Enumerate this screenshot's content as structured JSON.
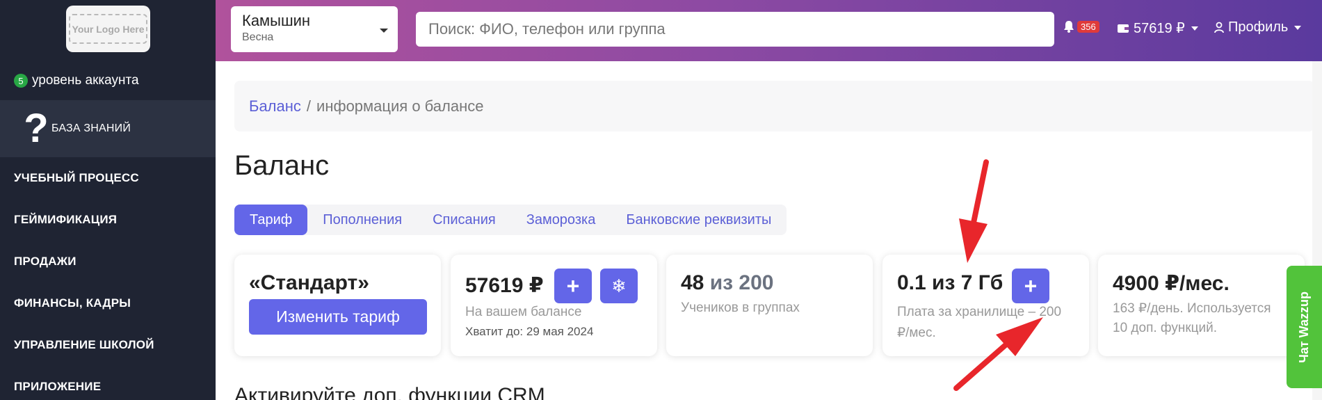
{
  "sidebar": {
    "logo_text": "Your Logo Here",
    "level_badge": "5",
    "level_text": "уровень аккаунта",
    "kb_icon": "?",
    "kb_label": "БАЗА ЗНАНИЙ",
    "items": [
      {
        "label": "УЧЕБНЫЙ ПРОЦЕСС"
      },
      {
        "label": "ГЕЙМИФИКАЦИЯ"
      },
      {
        "label": "ПРОДАЖИ"
      },
      {
        "label": "ФИНАНСЫ, КАДРЫ"
      },
      {
        "label": "УПРАВЛЕНИЕ ШКОЛОЙ"
      },
      {
        "label": "ПРИЛОЖЕНИЕ"
      }
    ]
  },
  "topbar": {
    "branch_name": "Камышин",
    "branch_sub": "Весна",
    "search_placeholder": "Поиск: ФИО, телефон или группа",
    "notifications": "356",
    "wallet": "57619 ₽",
    "profile": "Профиль"
  },
  "breadcrumb": {
    "link": "Баланс",
    "separator": "/",
    "current": "информация о балансе"
  },
  "page_title": "Баланс",
  "tabs": [
    {
      "label": "Тариф"
    },
    {
      "label": "Пополнения"
    },
    {
      "label": "Списания"
    },
    {
      "label": "Заморозка"
    },
    {
      "label": "Банковские реквизиты"
    }
  ],
  "cards": {
    "tariff": {
      "name": "«Стандарт»",
      "button": "Изменить тариф"
    },
    "balance": {
      "amount": "57619 ₽",
      "sub": "На вашем балансе",
      "until": "Хватит до: 29 мая 2024",
      "add_icon": "+",
      "freeze_icon": "❄"
    },
    "students": {
      "count": "48",
      "of": "из 200",
      "sub": "Учеников в группах"
    },
    "storage": {
      "value": "0.1 из 7 Гб",
      "sub_line1": "Плата за хранилище – 200",
      "sub_line2": "₽/мес.",
      "add_icon": "+"
    },
    "monthly": {
      "value": "4900 ₽/мес.",
      "sub_line1": "163 ₽/день. Используется",
      "sub_line2": "10 доп. функций."
    }
  },
  "section_title": "Активируйте доп. функции CRM",
  "wazzup_label": "Чат Wazzup",
  "colors": {
    "accent": "#6366e8",
    "sidebar": "#1f2433",
    "annotation": "#e8262b"
  }
}
